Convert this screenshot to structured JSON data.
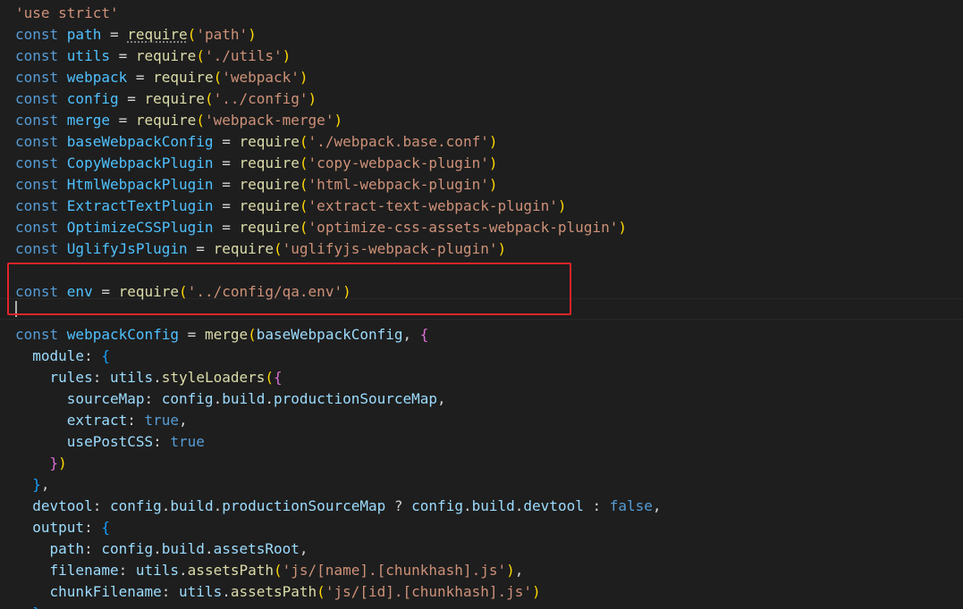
{
  "editor": {
    "language": "javascript",
    "theme": "dark",
    "annotation": {
      "color": "#e0242a",
      "highlighted_line": 14
    },
    "lines": [
      [
        {
          "t": "'use strict'",
          "c": "str"
        }
      ],
      [
        {
          "t": "const ",
          "c": "kw"
        },
        {
          "t": "path",
          "c": "const"
        },
        {
          "t": " = ",
          "c": "p"
        },
        {
          "t": "require",
          "c": "fn",
          "s": true
        },
        {
          "t": "(",
          "c": "b1"
        },
        {
          "t": "'path'",
          "c": "str"
        },
        {
          "t": ")",
          "c": "b1"
        }
      ],
      [
        {
          "t": "const ",
          "c": "kw"
        },
        {
          "t": "utils",
          "c": "const"
        },
        {
          "t": " = ",
          "c": "p"
        },
        {
          "t": "require",
          "c": "fn"
        },
        {
          "t": "(",
          "c": "b1"
        },
        {
          "t": "'./utils'",
          "c": "str"
        },
        {
          "t": ")",
          "c": "b1"
        }
      ],
      [
        {
          "t": "const ",
          "c": "kw"
        },
        {
          "t": "webpack",
          "c": "const"
        },
        {
          "t": " = ",
          "c": "p"
        },
        {
          "t": "require",
          "c": "fn"
        },
        {
          "t": "(",
          "c": "b1"
        },
        {
          "t": "'webpack'",
          "c": "str"
        },
        {
          "t": ")",
          "c": "b1"
        }
      ],
      [
        {
          "t": "const ",
          "c": "kw"
        },
        {
          "t": "config",
          "c": "const"
        },
        {
          "t": " = ",
          "c": "p"
        },
        {
          "t": "require",
          "c": "fn"
        },
        {
          "t": "(",
          "c": "b1"
        },
        {
          "t": "'../config'",
          "c": "str"
        },
        {
          "t": ")",
          "c": "b1"
        }
      ],
      [
        {
          "t": "const ",
          "c": "kw"
        },
        {
          "t": "merge",
          "c": "const"
        },
        {
          "t": " = ",
          "c": "p"
        },
        {
          "t": "require",
          "c": "fn"
        },
        {
          "t": "(",
          "c": "b1"
        },
        {
          "t": "'webpack-merge'",
          "c": "str"
        },
        {
          "t": ")",
          "c": "b1"
        }
      ],
      [
        {
          "t": "const ",
          "c": "kw"
        },
        {
          "t": "baseWebpackConfig",
          "c": "const"
        },
        {
          "t": " = ",
          "c": "p"
        },
        {
          "t": "require",
          "c": "fn"
        },
        {
          "t": "(",
          "c": "b1"
        },
        {
          "t": "'./webpack.base.conf'",
          "c": "str"
        },
        {
          "t": ")",
          "c": "b1"
        }
      ],
      [
        {
          "t": "const ",
          "c": "kw"
        },
        {
          "t": "CopyWebpackPlugin",
          "c": "const"
        },
        {
          "t": " = ",
          "c": "p"
        },
        {
          "t": "require",
          "c": "fn"
        },
        {
          "t": "(",
          "c": "b1"
        },
        {
          "t": "'copy-webpack-plugin'",
          "c": "str"
        },
        {
          "t": ")",
          "c": "b1"
        }
      ],
      [
        {
          "t": "const ",
          "c": "kw"
        },
        {
          "t": "HtmlWebpackPlugin",
          "c": "const"
        },
        {
          "t": " = ",
          "c": "p"
        },
        {
          "t": "require",
          "c": "fn"
        },
        {
          "t": "(",
          "c": "b1"
        },
        {
          "t": "'html-webpack-plugin'",
          "c": "str"
        },
        {
          "t": ")",
          "c": "b1"
        }
      ],
      [
        {
          "t": "const ",
          "c": "kw"
        },
        {
          "t": "ExtractTextPlugin",
          "c": "const"
        },
        {
          "t": " = ",
          "c": "p"
        },
        {
          "t": "require",
          "c": "fn"
        },
        {
          "t": "(",
          "c": "b1"
        },
        {
          "t": "'extract-text-webpack-plugin'",
          "c": "str"
        },
        {
          "t": ")",
          "c": "b1"
        }
      ],
      [
        {
          "t": "const ",
          "c": "kw"
        },
        {
          "t": "OptimizeCSSPlugin",
          "c": "const"
        },
        {
          "t": " = ",
          "c": "p"
        },
        {
          "t": "require",
          "c": "fn"
        },
        {
          "t": "(",
          "c": "b1"
        },
        {
          "t": "'optimize-css-assets-webpack-plugin'",
          "c": "str"
        },
        {
          "t": ")",
          "c": "b1"
        }
      ],
      [
        {
          "t": "const ",
          "c": "kw"
        },
        {
          "t": "UglifyJsPlugin",
          "c": "const"
        },
        {
          "t": " = ",
          "c": "p"
        },
        {
          "t": "require",
          "c": "fn"
        },
        {
          "t": "(",
          "c": "b1"
        },
        {
          "t": "'uglifyjs-webpack-plugin'",
          "c": "str"
        },
        {
          "t": ")",
          "c": "b1"
        }
      ],
      [],
      [
        {
          "t": "const ",
          "c": "kw"
        },
        {
          "t": "env",
          "c": "const"
        },
        {
          "t": " = ",
          "c": "p"
        },
        {
          "t": "require",
          "c": "fn"
        },
        {
          "t": "(",
          "c": "b1"
        },
        {
          "t": "'../config/qa.env'",
          "c": "str"
        },
        {
          "t": ")",
          "c": "b1"
        }
      ],
      [],
      [
        {
          "t": "const ",
          "c": "kw"
        },
        {
          "t": "webpackConfig",
          "c": "const"
        },
        {
          "t": " = ",
          "c": "p"
        },
        {
          "t": "merge",
          "c": "fn"
        },
        {
          "t": "(",
          "c": "b1"
        },
        {
          "t": "baseWebpackConfig",
          "c": "var"
        },
        {
          "t": ", ",
          "c": "p"
        },
        {
          "t": "{",
          "c": "b2"
        }
      ],
      [
        {
          "t": "  ",
          "c": "p"
        },
        {
          "t": "module",
          "c": "prop"
        },
        {
          "t": ": ",
          "c": "p"
        },
        {
          "t": "{",
          "c": "b3"
        }
      ],
      [
        {
          "t": "    ",
          "c": "p"
        },
        {
          "t": "rules",
          "c": "prop"
        },
        {
          "t": ": ",
          "c": "p"
        },
        {
          "t": "utils",
          "c": "var"
        },
        {
          "t": ".",
          "c": "p"
        },
        {
          "t": "styleLoaders",
          "c": "fn"
        },
        {
          "t": "(",
          "c": "b1"
        },
        {
          "t": "{",
          "c": "b2"
        }
      ],
      [
        {
          "t": "      ",
          "c": "p"
        },
        {
          "t": "sourceMap",
          "c": "prop"
        },
        {
          "t": ": ",
          "c": "p"
        },
        {
          "t": "config",
          "c": "var"
        },
        {
          "t": ".",
          "c": "p"
        },
        {
          "t": "build",
          "c": "var"
        },
        {
          "t": ".",
          "c": "p"
        },
        {
          "t": "productionSourceMap",
          "c": "var"
        },
        {
          "t": ",",
          "c": "p"
        }
      ],
      [
        {
          "t": "      ",
          "c": "p"
        },
        {
          "t": "extract",
          "c": "prop"
        },
        {
          "t": ": ",
          "c": "p"
        },
        {
          "t": "true",
          "c": "bool"
        },
        {
          "t": ",",
          "c": "p"
        }
      ],
      [
        {
          "t": "      ",
          "c": "p"
        },
        {
          "t": "usePostCSS",
          "c": "prop"
        },
        {
          "t": ": ",
          "c": "p"
        },
        {
          "t": "true",
          "c": "bool"
        }
      ],
      [
        {
          "t": "    ",
          "c": "p"
        },
        {
          "t": "}",
          "c": "b2"
        },
        {
          "t": ")",
          "c": "b1"
        }
      ],
      [
        {
          "t": "  ",
          "c": "p"
        },
        {
          "t": "}",
          "c": "b3"
        },
        {
          "t": ",",
          "c": "p"
        }
      ],
      [
        {
          "t": "  ",
          "c": "p"
        },
        {
          "t": "devtool",
          "c": "prop"
        },
        {
          "t": ": ",
          "c": "p"
        },
        {
          "t": "config",
          "c": "var"
        },
        {
          "t": ".",
          "c": "p"
        },
        {
          "t": "build",
          "c": "var"
        },
        {
          "t": ".",
          "c": "p"
        },
        {
          "t": "productionSourceMap",
          "c": "var"
        },
        {
          "t": " ? ",
          "c": "p"
        },
        {
          "t": "config",
          "c": "var"
        },
        {
          "t": ".",
          "c": "p"
        },
        {
          "t": "build",
          "c": "var"
        },
        {
          "t": ".",
          "c": "p"
        },
        {
          "t": "devtool",
          "c": "var"
        },
        {
          "t": " : ",
          "c": "p"
        },
        {
          "t": "false",
          "c": "bool"
        },
        {
          "t": ",",
          "c": "p"
        }
      ],
      [
        {
          "t": "  ",
          "c": "p"
        },
        {
          "t": "output",
          "c": "prop"
        },
        {
          "t": ": ",
          "c": "p"
        },
        {
          "t": "{",
          "c": "b3"
        }
      ],
      [
        {
          "t": "    ",
          "c": "p"
        },
        {
          "t": "path",
          "c": "prop"
        },
        {
          "t": ": ",
          "c": "p"
        },
        {
          "t": "config",
          "c": "var"
        },
        {
          "t": ".",
          "c": "p"
        },
        {
          "t": "build",
          "c": "var"
        },
        {
          "t": ".",
          "c": "p"
        },
        {
          "t": "assetsRoot",
          "c": "var"
        },
        {
          "t": ",",
          "c": "p"
        }
      ],
      [
        {
          "t": "    ",
          "c": "p"
        },
        {
          "t": "filename",
          "c": "prop"
        },
        {
          "t": ": ",
          "c": "p"
        },
        {
          "t": "utils",
          "c": "var"
        },
        {
          "t": ".",
          "c": "p"
        },
        {
          "t": "assetsPath",
          "c": "fn"
        },
        {
          "t": "(",
          "c": "b1"
        },
        {
          "t": "'js/[name].[chunkhash].js'",
          "c": "str"
        },
        {
          "t": ")",
          "c": "b1"
        },
        {
          "t": ",",
          "c": "p"
        }
      ],
      [
        {
          "t": "    ",
          "c": "p"
        },
        {
          "t": "chunkFilename",
          "c": "prop"
        },
        {
          "t": ": ",
          "c": "p"
        },
        {
          "t": "utils",
          "c": "var"
        },
        {
          "t": ".",
          "c": "p"
        },
        {
          "t": "assetsPath",
          "c": "fn"
        },
        {
          "t": "(",
          "c": "b1"
        },
        {
          "t": "'js/[id].[chunkhash].js'",
          "c": "str"
        },
        {
          "t": ")",
          "c": "b1"
        }
      ],
      [
        {
          "t": "  ",
          "c": "p"
        },
        {
          "t": "},",
          "c": "b3"
        }
      ]
    ]
  }
}
